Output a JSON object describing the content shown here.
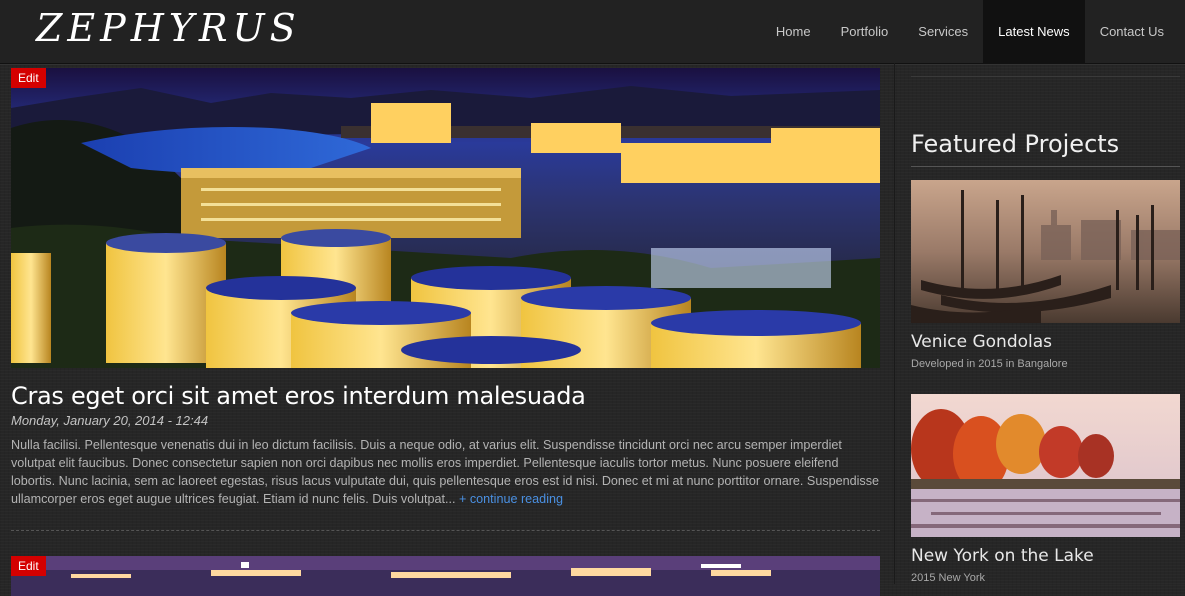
{
  "header": {
    "logo": "ZEPHYRUS",
    "nav": [
      {
        "label": "Home"
      },
      {
        "label": "Portfolio"
      },
      {
        "label": "Services"
      },
      {
        "label": "Latest News"
      },
      {
        "label": "Contact Us"
      }
    ],
    "active_index": 3
  },
  "post": {
    "edit_label": "Edit",
    "title": "Cras eget orci sit amet eros interdum malesuada",
    "date": "Monday, January 20, 2014 - 12:44",
    "excerpt": "Nulla facilisi. Pellentesque venenatis dui in leo dictum facilisis. Duis a neque odio, at varius elit. Suspendisse tincidunt orci nec arcu semper imperdiet volutpat elit faucibus. Donec consectetur sapien non orci dapibus nec mollis eros imperdiet. Pellentesque iaculis tortor metus. Nunc posuere eleifend lobortis. Nunc lacinia, sem ac laoreet egestas, risus lacus vulputate dui, quis pellentesque eros est id nisi. Donec et mi at nunc porttitor ornare. Suspendisse ullamcorper eros eget augue ultrices feugiat. Etiam id nunc felis. Duis volutpat...",
    "continue_label": "+ continue reading"
  },
  "post2": {
    "edit_label": "Edit"
  },
  "sidebar": {
    "title": "Featured Projects",
    "projects": [
      {
        "name": "Venice Gondolas",
        "meta": "Developed in 2015 in Bangalore"
      },
      {
        "name": "New York on the Lake",
        "meta": "2015 New York"
      }
    ]
  },
  "colors": {
    "accent_link": "#4a90e2",
    "edit_badge": "#d40000",
    "active_nav": "#111111"
  }
}
